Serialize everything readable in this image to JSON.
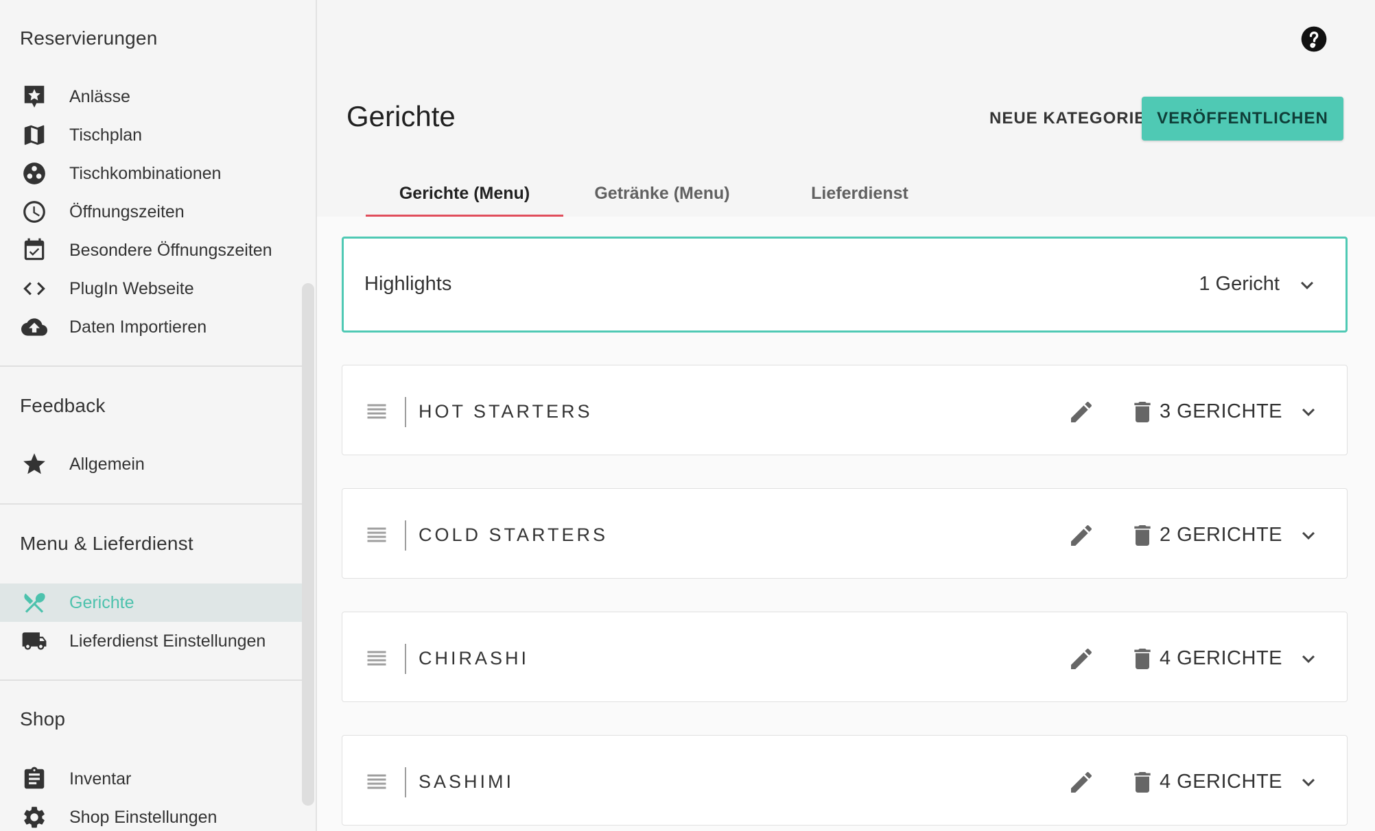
{
  "sidebar": {
    "sections": {
      "reservierungen": "Reservierungen",
      "feedback": "Feedback",
      "menu": "Menu & Lieferdienst",
      "shop": "Shop"
    },
    "items": {
      "anlaesse": "Anlässe",
      "tischplan": "Tischplan",
      "tischkombinationen": "Tischkombinationen",
      "oeffnungszeiten": "Öffnungszeiten",
      "besondere": "Besondere Öffnungszeiten",
      "plugin": "PlugIn Webseite",
      "import": "Daten Importieren",
      "allgemein": "Allgemein",
      "gerichte": "Gerichte",
      "lieferdienst_einstellungen": "Lieferdienst Einstellungen",
      "inventar": "Inventar",
      "shop_einstellungen": "Shop Einstellungen"
    },
    "active_item": "Gerichte"
  },
  "header": {
    "title": "Gerichte",
    "new_category": "NEUE KATEGORIE",
    "publish": "VERÖFFENTLICHEN"
  },
  "tabs": [
    "Gerichte (Menu)",
    "Getränke (Menu)",
    "Lieferdienst"
  ],
  "active_tab": "Gerichte (Menu)",
  "highlights": {
    "label": "Highlights",
    "count": "1 Gericht"
  },
  "categories": [
    {
      "name": "HOT STARTERS",
      "count": "3 GERICHTE"
    },
    {
      "name": "COLD STARTERS",
      "count": "2 GERICHTE"
    },
    {
      "name": "CHIRASHI",
      "count": "4 GERICHTE"
    },
    {
      "name": "SASHIMI",
      "count": "4 GERICHTE"
    }
  ],
  "colors": {
    "accent": "#4fc9b4",
    "tab_indicator": "#e04d5b",
    "active_bg": "#dfe6e6"
  }
}
